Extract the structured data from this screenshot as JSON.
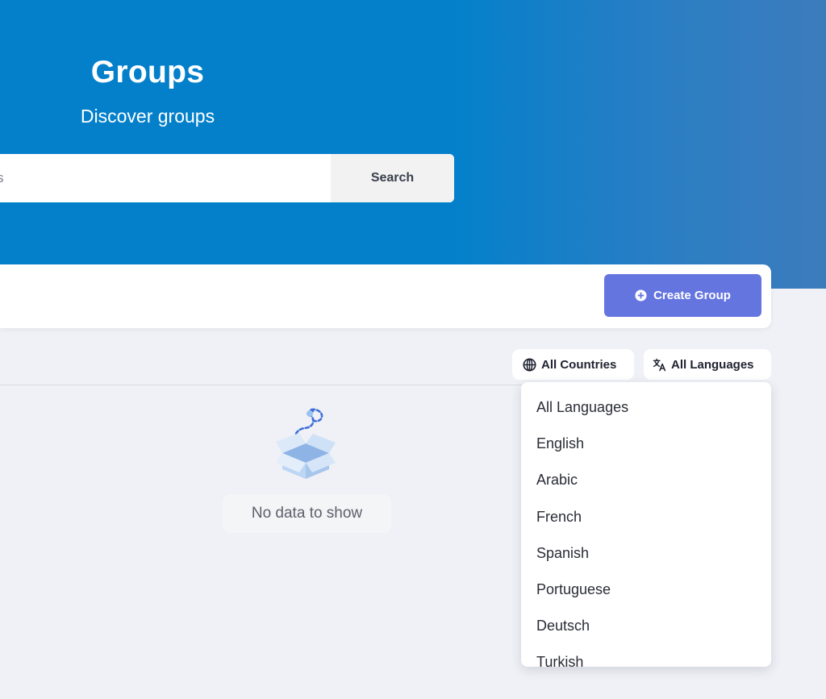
{
  "hero": {
    "title": "Groups",
    "subtitle": "Discover groups",
    "background_color": "#0480cb"
  },
  "search": {
    "value": "s",
    "button_label": "Search"
  },
  "toolbar": {
    "create_group_label": "Create Group",
    "create_group_icon": "plus-circle-icon",
    "accent_color": "#6475e0"
  },
  "filters": {
    "countries": {
      "label": "All Countries",
      "icon": "globe-icon"
    },
    "languages": {
      "label": "All Languages",
      "icon": "translate-icon"
    }
  },
  "empty_state": {
    "label": "No data to show",
    "icon": "empty-box-icon"
  },
  "language_dropdown": {
    "items": [
      {
        "label": "All Languages"
      },
      {
        "label": "English"
      },
      {
        "label": "Arabic"
      },
      {
        "label": "French"
      },
      {
        "label": "Spanish"
      },
      {
        "label": "Portuguese"
      },
      {
        "label": "Deutsch"
      },
      {
        "label": "Turkish"
      }
    ]
  }
}
